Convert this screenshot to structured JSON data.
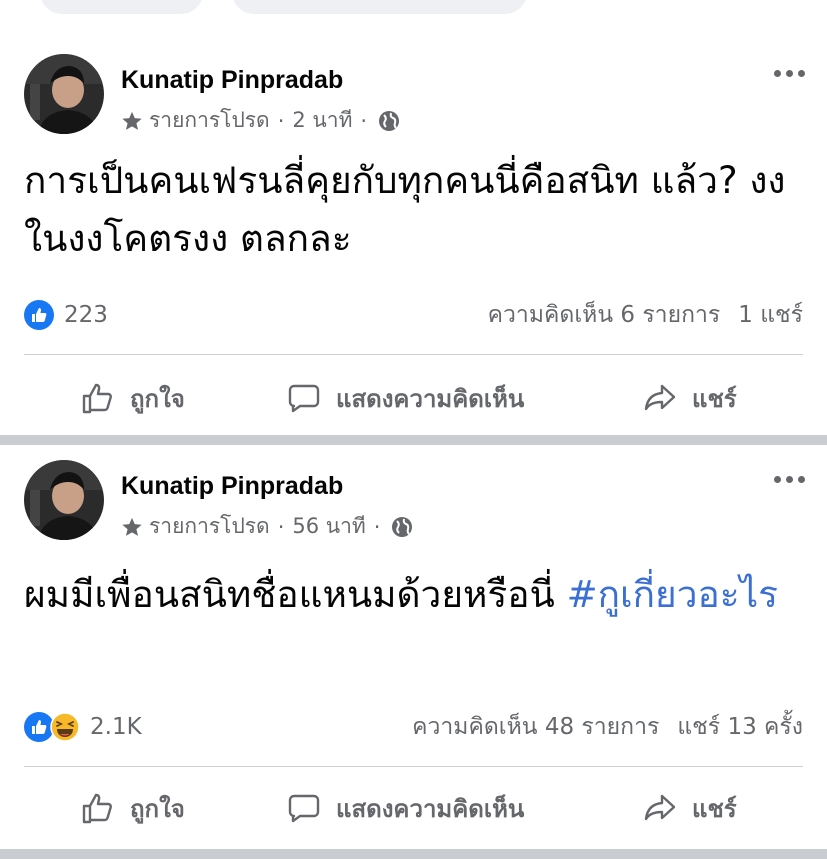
{
  "posts": [
    {
      "author": "Kunatip Pinpradab",
      "audience": "รายการโปรด",
      "time": "2 นาที",
      "text_parts": [
        "การเป็นคนเฟรนลี่คุยกับทุกคนนี่คือสนิท แล้ว? งงในงงโคตรงง ตลกละ"
      ],
      "hashtag": "",
      "reactions": [
        "like-icon"
      ],
      "reaction_count": "223",
      "comments": "ความคิดเห็น 6 รายการ",
      "shares": "1 แชร์"
    },
    {
      "author": "Kunatip Pinpradab",
      "audience": "รายการโปรด",
      "time": "56 นาที",
      "text_parts": [
        "ผมมีเพื่อนสนิทชื่อแหนมด้วยหรือนี่ "
      ],
      "hashtag": "#กูเกี่ยวอะไร",
      "reactions": [
        "like-icon",
        "haha-icon"
      ],
      "reaction_count": "2.1K",
      "comments": "ความคิดเห็น 48 รายการ",
      "shares": "แชร์ 13 ครั้ง"
    }
  ],
  "actions": {
    "like": "ถูกใจ",
    "comment": "แสดงความคิดเห็น",
    "share": "แชร์"
  },
  "colors": {
    "like_blue": "#1877f2",
    "hashtag": "#3b6fd4",
    "secondary_text": "#65676b",
    "separator": "#c9ccd1"
  }
}
